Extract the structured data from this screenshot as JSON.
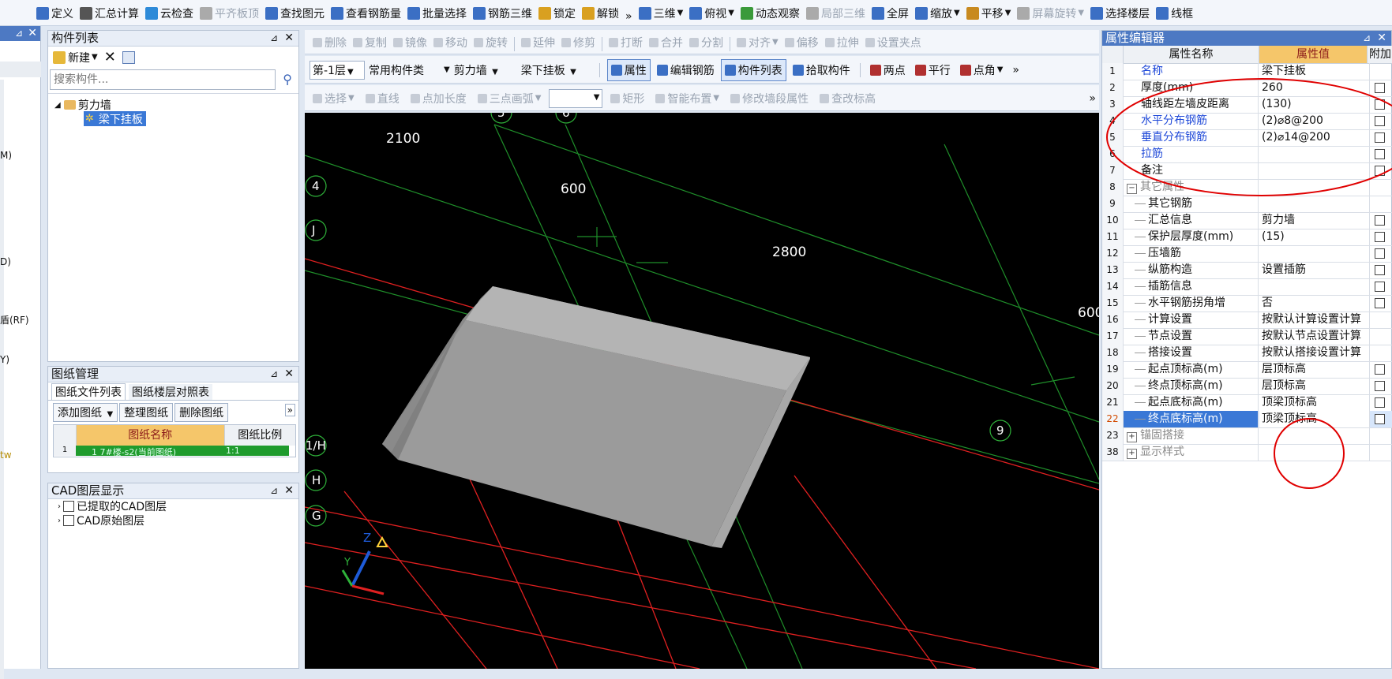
{
  "toolbar1": {
    "items": [
      "定义",
      "汇总计算",
      "云检查",
      "平齐板顶",
      "查找图元",
      "查看钢筋量",
      "批量选择",
      "钢筋三维",
      "锁定",
      "解锁",
      "三维",
      "俯视",
      "动态观察",
      "局部三维",
      "全屏",
      "缩放",
      "平移",
      "屏幕旋转",
      "选择楼层",
      "线框"
    ],
    "more": "»"
  },
  "toolbar2": {
    "items": [
      "删除",
      "复制",
      "镜像",
      "移动",
      "旋转",
      "延伸",
      "修剪",
      "打断",
      "合并",
      "分割",
      "对齐",
      "偏移",
      "拉伸",
      "设置夹点"
    ]
  },
  "toolbar3": {
    "floor": "第-1层",
    "category": "常用构件类",
    "type": "剪力墙",
    "component": "梁下挂板",
    "items": [
      "属性",
      "编辑钢筋",
      "构件列表",
      "拾取构件",
      "两点",
      "平行",
      "点角"
    ],
    "more": "»"
  },
  "toolbar4": {
    "items": [
      "选择",
      "直线",
      "点加长度",
      "三点画弧",
      "矩形",
      "智能布置",
      "修改墙段属性",
      "查改标高"
    ],
    "more": "»"
  },
  "component_list": {
    "title": "构件列表",
    "new_label": "新建",
    "search_placeholder": "搜索构件...",
    "tree_parent": "剪力墙",
    "tree_child": "梁下挂板"
  },
  "drawing_mgmt": {
    "title": "图纸管理",
    "tabs": [
      "图纸文件列表",
      "图纸楼层对照表"
    ],
    "buttons": [
      "添加图纸",
      "整理图纸",
      "删除图纸"
    ],
    "col_name": "图纸名称",
    "col_scale": "图纸比例",
    "row_num": "1",
    "row_name": "1  7#楼-s2(当前图纸)",
    "row_scale": "1:1"
  },
  "cad_layers": {
    "title": "CAD图层显示",
    "items": [
      "已提取的CAD图层",
      "CAD原始图层"
    ]
  },
  "left_edge": {
    "labels": [
      "M)",
      "D)",
      "盾(RF)",
      "Y)",
      "tw"
    ]
  },
  "canvas": {
    "dims": [
      "2100",
      "600",
      "2800",
      "600"
    ],
    "axis_labels": [
      "5",
      "6",
      "4",
      "J",
      "1/H",
      "H",
      "G",
      "9"
    ],
    "axes_z": "Z",
    "axes_y": "Y"
  },
  "properties": {
    "title": "属性编辑器",
    "headers": {
      "name": "属性名称",
      "value": "属性值",
      "extra": "附加"
    },
    "rows": [
      {
        "n": "1",
        "name": "名称",
        "value": "梁下挂板",
        "style": "blue",
        "indent": 1,
        "cb": false
      },
      {
        "n": "2",
        "name": "厚度(mm)",
        "value": "260",
        "style": "",
        "indent": 1,
        "cb": true
      },
      {
        "n": "3",
        "name": "轴线距左墙皮距离",
        "value": "(130)",
        "style": "",
        "indent": 1,
        "cb": true
      },
      {
        "n": "4",
        "name": "水平分布钢筋",
        "value": "(2)⌀8@200",
        "style": "blue",
        "indent": 1,
        "cb": true
      },
      {
        "n": "5",
        "name": "垂直分布钢筋",
        "value": "(2)⌀14@200",
        "style": "blue",
        "indent": 1,
        "cb": true
      },
      {
        "n": "6",
        "name": "拉筋",
        "value": "",
        "style": "blue",
        "indent": 1,
        "cb": true
      },
      {
        "n": "7",
        "name": "备注",
        "value": "",
        "style": "",
        "indent": 1,
        "cb": true
      },
      {
        "n": "8",
        "name": "其它属性",
        "value": "",
        "style": "gray",
        "indent": 0,
        "expander": "−",
        "cb": false
      },
      {
        "n": "9",
        "name": "其它钢筋",
        "value": "",
        "style": "",
        "indent": 2,
        "cb": false
      },
      {
        "n": "10",
        "name": "汇总信息",
        "value": "剪力墙",
        "style": "",
        "indent": 2,
        "cb": true
      },
      {
        "n": "11",
        "name": "保护层厚度(mm)",
        "value": "(15)",
        "style": "",
        "indent": 2,
        "cb": true
      },
      {
        "n": "12",
        "name": "压墙筋",
        "value": "",
        "style": "",
        "indent": 2,
        "cb": true
      },
      {
        "n": "13",
        "name": "纵筋构造",
        "value": "设置插筋",
        "style": "",
        "indent": 2,
        "cb": true
      },
      {
        "n": "14",
        "name": "插筋信息",
        "value": "",
        "style": "",
        "indent": 2,
        "cb": true
      },
      {
        "n": "15",
        "name": "水平钢筋拐角增",
        "value": "否",
        "style": "",
        "indent": 2,
        "cb": true
      },
      {
        "n": "16",
        "name": "计算设置",
        "value": "按默认计算设置计算",
        "style": "",
        "indent": 2,
        "cb": false
      },
      {
        "n": "17",
        "name": "节点设置",
        "value": "按默认节点设置计算",
        "style": "",
        "indent": 2,
        "cb": false
      },
      {
        "n": "18",
        "name": "搭接设置",
        "value": "按默认搭接设置计算",
        "style": "",
        "indent": 2,
        "cb": false
      },
      {
        "n": "19",
        "name": "起点顶标高(m)",
        "value": "层顶标高",
        "style": "",
        "indent": 2,
        "cb": true
      },
      {
        "n": "20",
        "name": "终点顶标高(m)",
        "value": "层顶标高",
        "style": "",
        "indent": 2,
        "cb": true
      },
      {
        "n": "21",
        "name": "起点底标高(m)",
        "value": "顶梁顶标高",
        "style": "",
        "indent": 2,
        "cb": true
      },
      {
        "n": "22",
        "name": "终点底标高(m)",
        "value": "顶梁顶标高",
        "style": "selected",
        "indent": 2,
        "cb": true
      },
      {
        "n": "23",
        "name": "锚固搭接",
        "value": "",
        "style": "gray",
        "indent": 0,
        "expander": "+",
        "cb": false
      },
      {
        "n": "38",
        "name": "显示样式",
        "value": "",
        "style": "gray",
        "indent": 0,
        "expander": "+",
        "cb": false
      }
    ]
  },
  "colors": {
    "title_bar": "#4d79c3",
    "axis_red": "#e02020",
    "grid_green": "#1f8f2a",
    "annotation_red": "#e00000"
  }
}
